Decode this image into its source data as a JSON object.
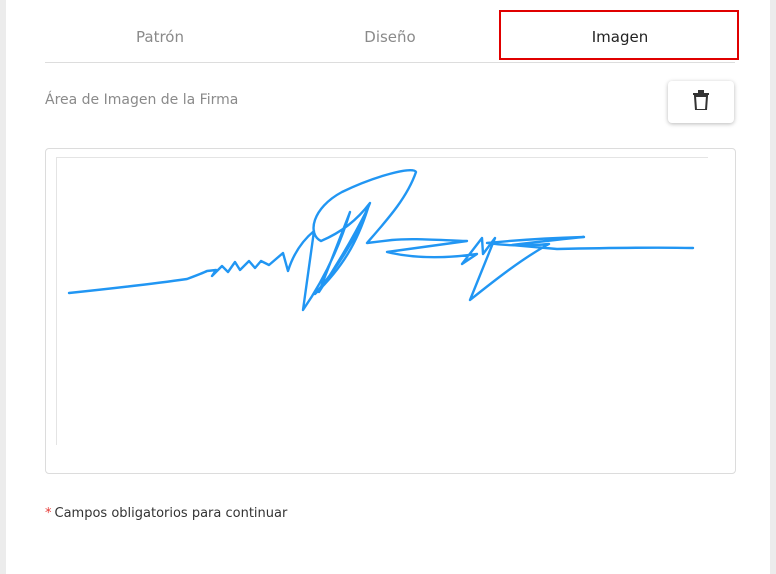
{
  "tabs": [
    {
      "label": "Patrón",
      "active": false
    },
    {
      "label": "Diseño",
      "active": false
    },
    {
      "label": "Imagen",
      "active": true
    }
  ],
  "signature_area": {
    "label": "Área de Imagen de la Firma",
    "delete_icon": "trash-icon",
    "stroke_color": "#2196f3"
  },
  "footer": {
    "asterisk": "*",
    "required_note": "Campos obligatorios para continuar"
  },
  "colors": {
    "highlight": "#e00000",
    "signature": "#2196f3",
    "required_asterisk": "#e53935"
  }
}
